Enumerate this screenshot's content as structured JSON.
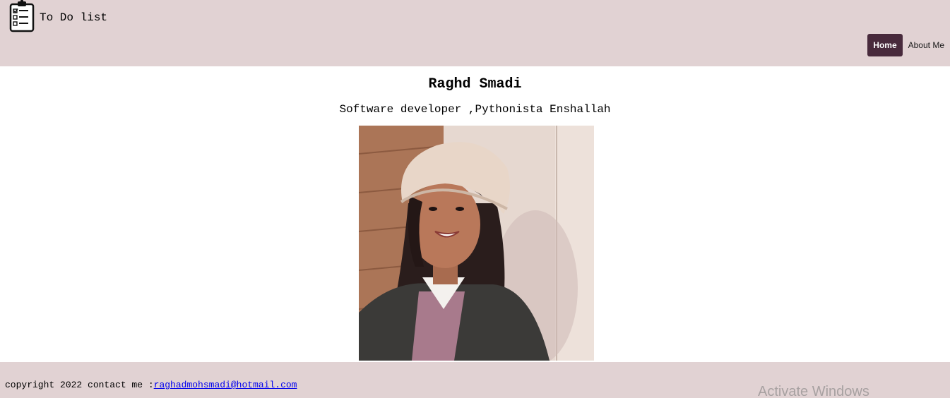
{
  "header": {
    "brand": "To Do list",
    "logo_icon": "clipboard-checklist-icon",
    "nav": [
      {
        "label": "Home",
        "active": true
      },
      {
        "label": "About Me",
        "active": false
      }
    ]
  },
  "profile": {
    "name": "Raghd Smadi",
    "tagline": "Software developer ,Pythonista Enshallah"
  },
  "footer": {
    "copyright_text": "copyright 2022 contact me :",
    "email": "raghadmohsmadi@hotmail.com"
  },
  "overlay": {
    "watermark": "Activate Windows"
  },
  "colors": {
    "bar_bg": "#e1d2d3",
    "active_nav": "#482a3c",
    "link": "#0000ee"
  }
}
